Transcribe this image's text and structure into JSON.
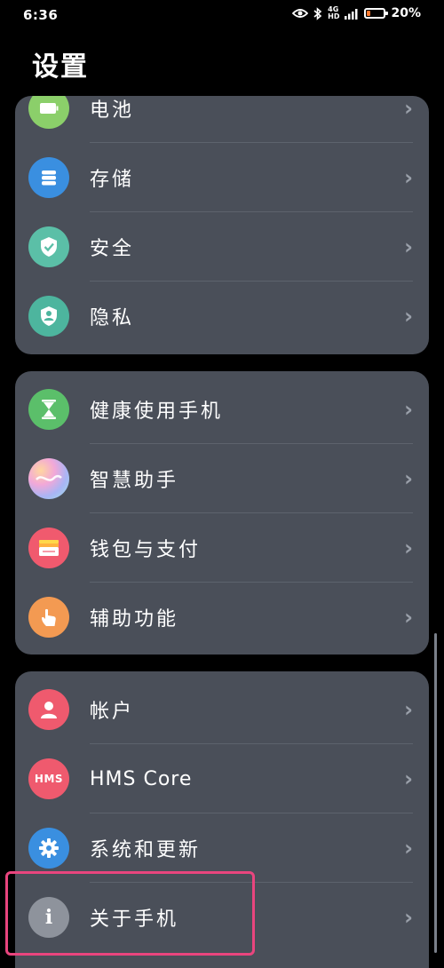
{
  "status_bar": {
    "time": "6:36",
    "network": [
      "4G",
      "HD"
    ],
    "battery_percent": "20%",
    "battery_level": 0.2
  },
  "page": {
    "title": "设置"
  },
  "groups": [
    {
      "items": [
        {
          "label": "电池",
          "icon": "battery-icon",
          "color": "#8bcf6a"
        },
        {
          "label": "存储",
          "icon": "storage-icon",
          "color": "#3a8fe0"
        },
        {
          "label": "安全",
          "icon": "shield-check-icon",
          "color": "#5bbfa7"
        },
        {
          "label": "隐私",
          "icon": "privacy-person-icon",
          "color": "#4db59e"
        }
      ]
    },
    {
      "items": [
        {
          "label": "健康使用手机",
          "icon": "hourglass-icon",
          "color": "#5bbf6a"
        },
        {
          "label": "智慧助手",
          "icon": "assistant-icon",
          "color": "#c9a8ef"
        },
        {
          "label": "钱包与支付",
          "icon": "wallet-icon",
          "color": "#f05a6e"
        },
        {
          "label": "辅助功能",
          "icon": "hand-icon",
          "color": "#f39a52"
        }
      ]
    },
    {
      "items": [
        {
          "label": "帐户",
          "icon": "account-icon",
          "color": "#ef5a6e"
        },
        {
          "label": "HMS Core",
          "icon": "hms-icon",
          "icon_text": "HMS",
          "color": "#ef5a6e"
        },
        {
          "label": "系统和更新",
          "icon": "settings-gear-icon",
          "color": "#3a8fe0"
        },
        {
          "label": "关于手机",
          "icon": "info-icon",
          "icon_text": "i",
          "color": "#8e939c"
        }
      ]
    }
  ]
}
